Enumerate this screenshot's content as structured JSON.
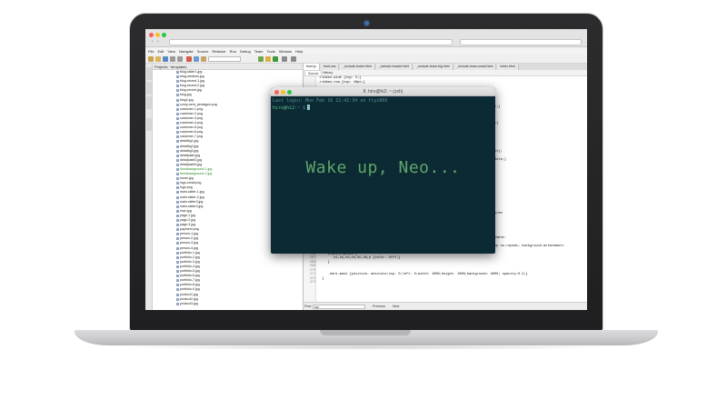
{
  "colors": {
    "terminal_bg": "#0c2a33",
    "terminal_text": "#5ea66a",
    "close": "#fc5f57",
    "minimize": "#fdbc2e",
    "maximize": "#28c840"
  },
  "terminal": {
    "title": "8. hiro@hi2: ~ (zsh)",
    "last_login": "Last login: Mon Feb 16 11:42:34 on ttys009",
    "prompt_user": "hiro@hi2",
    "prompt_suffix": ":~ $",
    "message": "Wake up, Neo..."
  },
  "ide": {
    "menu": [
      "File",
      "Edit",
      "View",
      "Navigate",
      "Source",
      "Refactor",
      "Run",
      "Debug",
      "Team",
      "Tools",
      "Window",
      "Help"
    ],
    "project_panel_title": "Projects · templates",
    "files": [
      {
        "name": "blog-slider1.jpg",
        "modified": false
      },
      {
        "name": "blog-medium.jpg",
        "modified": false
      },
      {
        "name": "blog-recent-1.jpg",
        "modified": false
      },
      {
        "name": "blog-recent-2.jpg",
        "modified": false
      },
      {
        "name": "blog-recent.jpg",
        "modified": false
      },
      {
        "name": "blog.jpg",
        "modified": false
      },
      {
        "name": "blog2.jpg",
        "modified": false
      },
      {
        "name": "comp-sent_pentagon.png",
        "modified": false
      },
      {
        "name": "customer-1.png",
        "modified": false
      },
      {
        "name": "customer-2.png",
        "modified": false
      },
      {
        "name": "customer-3.png",
        "modified": false
      },
      {
        "name": "customer-4.png",
        "modified": false
      },
      {
        "name": "customer-5.png",
        "modified": false
      },
      {
        "name": "customer-6.png",
        "modified": false
      },
      {
        "name": "customer-7.png",
        "modified": false
      },
      {
        "name": "detailbg1.jpg",
        "modified": false
      },
      {
        "name": "detailbg2.jpg",
        "modified": false
      },
      {
        "name": "detailbg3.jpg",
        "modified": false
      },
      {
        "name": "detailpaint.jpg",
        "modified": false
      },
      {
        "name": "detailpaint2.jpg",
        "modified": false
      },
      {
        "name": "detailpaint3.jpg",
        "modified": false
      },
      {
        "name": "fixedbackground-1.jpg",
        "modified": true
      },
      {
        "name": "fixedbackground-2.jpg",
        "modified": true
      },
      {
        "name": "home.jpg",
        "modified": false
      },
      {
        "name": "logo-small.png",
        "modified": false
      },
      {
        "name": "logo.png",
        "modified": false
      },
      {
        "name": "main-slider-1.jpg",
        "modified": false
      },
      {
        "name": "main-slider-2.jpg",
        "modified": false
      },
      {
        "name": "main-slider3.jpg",
        "modified": false
      },
      {
        "name": "main-slider4.jpg",
        "modified": false
      },
      {
        "name": "man.jpg",
        "modified": false
      },
      {
        "name": "page-1.jpg",
        "modified": false
      },
      {
        "name": "page-2.jpg",
        "modified": false
      },
      {
        "name": "page-3.jpg",
        "modified": false
      },
      {
        "name": "payment.png",
        "modified": false
      },
      {
        "name": "person-1.jpg",
        "modified": false
      },
      {
        "name": "person-2.jpg",
        "modified": false
      },
      {
        "name": "person-3.jpg",
        "modified": false
      },
      {
        "name": "person-4.jpg",
        "modified": false
      },
      {
        "name": "portfolio-1.jpg",
        "modified": false
      },
      {
        "name": "portfolio-2.jpg",
        "modified": false
      },
      {
        "name": "portfolio-3.jpg",
        "modified": false
      },
      {
        "name": "portfolio-4.jpg",
        "modified": false
      },
      {
        "name": "portfolio-5.jpg",
        "modified": false
      },
      {
        "name": "portfolio-6.jpg",
        "modified": false
      },
      {
        "name": "portfolio-7.jpg",
        "modified": false
      },
      {
        "name": "portfolio-8.jpg",
        "modified": false
      },
      {
        "name": "portfolio-9.jpg",
        "modified": false
      },
      {
        "name": "product1.jpg",
        "modified": false
      },
      {
        "name": "product2.jpg",
        "modified": false
      },
      {
        "name": "product3.jpg",
        "modified": false
      }
    ],
    "editor_tabs": [
      {
        "label": "front.js",
        "active": true
      },
      {
        "label": "front.css",
        "active": false
      },
      {
        "label": "_include-footer.html",
        "active": false
      },
      {
        "label": "_include-header.html",
        "active": false
      },
      {
        "label": "_include-team-big.html",
        "active": false
      },
      {
        "label": "_include-team-small.html",
        "active": false
      },
      {
        "label": "index.html",
        "active": false
      }
    ],
    "editor_subtabs": [
      "Source",
      "History"
    ],
    "code_lines": [
      {
        "n": "",
        "text": ".ribbon.wide {top: 5;}"
      },
      {
        "n": "",
        "text": ".ribbon.row {top: 10px;}"
      },
      {
        "n": "",
        "text": ""
      },
      {
        "n": "",
        "text": "                                                    -left, 20% transparent transparent;}"
      },
      {
        "n": "",
        "text": ""
      },
      {
        "n": "",
        "text": ""
      },
      {
        "n": "",
        "text": ""
      },
      {
        "n": "",
        "text": "                                                 brand-success, 20% transparent transparent;}"
      },
      {
        "n": "",
        "text": ""
      },
      {
        "n": "",
        "text": ""
      },
      {
        "n": "",
        "text": ""
      },
      {
        "n": "",
        "text": "                                                    : padding: 10px 0; margin-bottom: 40px;}"
      },
      {
        "n": "",
        "text": ""
      },
      {
        "n": "",
        "text": "                                                    size-h1 + 10; font-weight: 500;}"
      },
      {
        "n": "",
        "text": ""
      },
      {
        "n": "",
        "text": ""
      },
      {
        "n": "",
        "text": ""
      },
      {
        "n": "",
        "text": ""
      },
      {
        "n": "",
        "text": "                                                    ewpy; line-height: (headings-line-height);"
      },
      {
        "n": "",
        "text": ""
      },
      {
        "n": "",
        "text": "                                                    100%; height: 70px; vertical-align: middle;}"
      },
      {
        "n": "",
        "text": ""
      },
      {
        "n": "",
        "text": ""
      },
      {
        "n": "",
        "text": ""
      },
      {
        "n": "",
        "text": ""
      },
      {
        "n": "",
        "text": ""
      },
      {
        "n": "",
        "text": ""
      },
      {
        "n": "",
        "text": ""
      },
      {
        "n": "",
        "text": ""
      },
      {
        "n": "",
        "text": "                                                    (brand-primary);"
      },
      {
        "n": "",
        "text": ""
      },
      {
        "n": "",
        "text": ""
      },
      {
        "n": "",
        "text": ""
      },
      {
        "n": "",
        "text": "                                                    center repeat; border-top: solid 1px #bree"
      },
      {
        "n": "",
        "text": ""
      },
      {
        "n": "",
        "text": ""
      },
      {
        "n": "",
        "text": ""
      },
      {
        "n": "",
        "text": ""
      },
      {
        "n": "",
        "text": ""
      },
      {
        "n": "",
        "text": "                                                    center top no-repeat; background-attachment:"
      },
      {
        "n": "",
        "text": "  } screen) {"
      },
      {
        "n": "",
        "text": "     &.background-image-fixed-2 {background: url('../img/fixed-background-2.jpg') center top no-repeat; background-attachment:"
      },
      {
        "n": "",
        "text": "  } screen) {"
      },
      {
        "n": "266",
        "text": "     &.white-white {"
      },
      {
        "n": "267",
        "text": "        h1,h2,h3,h4,h5,h6,p {color: #fff;}"
      },
      {
        "n": "268",
        "text": "     }"
      },
      {
        "n": "269",
        "text": ""
      },
      {
        "n": "270",
        "text": ""
      },
      {
        "n": "271",
        "text": "     .dark-mask {position: absolute;top: 0;left: 0;width: 100%;height: 100%;background: #000; opacity:0.3;}"
      },
      {
        "n": "272",
        "text": "  }"
      },
      {
        "n": "273",
        "text": ""
      }
    ],
    "find_label": "Find:",
    "find_value": "bar",
    "find_previous": "Previous",
    "find_next": "Next"
  }
}
